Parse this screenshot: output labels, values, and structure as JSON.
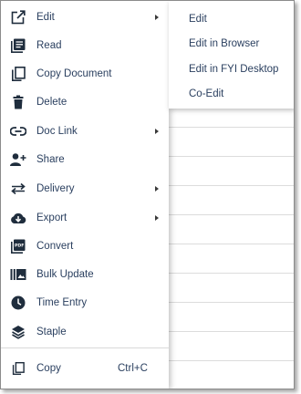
{
  "menu": {
    "items": [
      {
        "label": "Edit",
        "icon": "external-edit-icon",
        "submenu": true
      },
      {
        "label": "Read",
        "icon": "read-icon",
        "submenu": false
      },
      {
        "label": "Copy Document",
        "icon": "copy-document-icon",
        "submenu": false
      },
      {
        "label": "Delete",
        "icon": "trash-icon",
        "submenu": false
      },
      {
        "label": "Doc Link",
        "icon": "link-icon",
        "submenu": true
      },
      {
        "label": "Share",
        "icon": "add-person-icon",
        "submenu": false
      },
      {
        "label": "Delivery",
        "icon": "swap-arrows-icon",
        "submenu": true
      },
      {
        "label": "Export",
        "icon": "cloud-download-icon",
        "submenu": true
      },
      {
        "label": "Convert",
        "icon": "pdf-icon",
        "submenu": false
      },
      {
        "label": "Bulk Update",
        "icon": "bulk-update-icon",
        "submenu": false
      },
      {
        "label": "Time Entry",
        "icon": "clock-icon",
        "submenu": false
      },
      {
        "label": "Staple",
        "icon": "layers-icon",
        "submenu": false
      }
    ],
    "copy": {
      "label": "Copy",
      "shortcut": "Ctrl+C",
      "icon": "copy-icon"
    }
  },
  "edit_submenu": {
    "items": [
      {
        "label": "Edit"
      },
      {
        "label": "Edit in Browser"
      },
      {
        "label": "Edit in FYI Desktop"
      },
      {
        "label": "Co-Edit"
      }
    ]
  },
  "colors": {
    "text": "#2a3f5f",
    "icon": "#1f2d3d",
    "divider": "#d9d9d9"
  }
}
